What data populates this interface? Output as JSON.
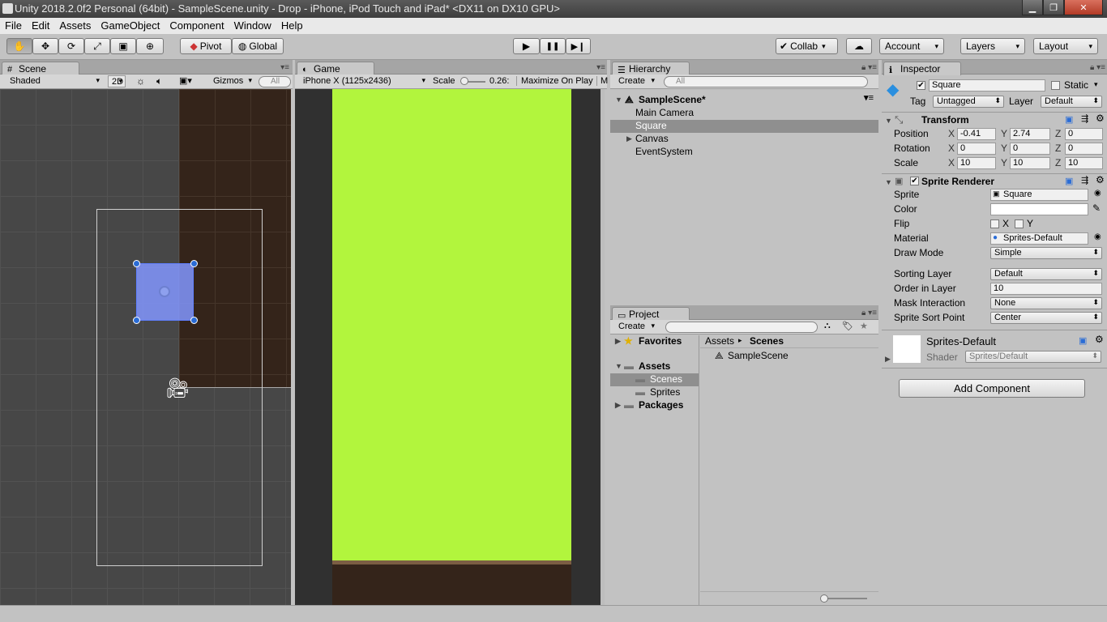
{
  "window": {
    "title": "Unity 2018.2.0f2 Personal (64bit) - SampleScene.unity - Drop - iPhone, iPod Touch and iPad* <DX11 on DX10 GPU>",
    "minimize": "▁",
    "maximize": "❐",
    "close": "✕"
  },
  "menu": [
    "File",
    "Edit",
    "Assets",
    "GameObject",
    "Component",
    "Window",
    "Help"
  ],
  "toolbar": {
    "tools": [
      "hand-icon",
      "move-icon",
      "rotate-icon",
      "scale-icon",
      "rect-icon",
      "transform-icon"
    ],
    "pivot": "Pivot",
    "global": "Global",
    "play": "▶",
    "pause": "❚❚",
    "step": "▶❙",
    "collab": "Collab",
    "account": "Account",
    "layers": "Layers",
    "layout": "Layout"
  },
  "scene": {
    "tab": "Scene",
    "shading": "Shaded",
    "mode2d": "2D",
    "gizmos": "Gizmos",
    "search": "All"
  },
  "game": {
    "tab": "Game",
    "resolution": "iPhone X (1125x2436)",
    "scale_label": "Scale",
    "scale_value": "0.26:",
    "maximize": "Maximize On Play",
    "more": "M",
    "bg_color": "#b2f53d",
    "ground_color": "#34241a"
  },
  "hierarchy": {
    "tab": "Hierarchy",
    "create": "Create",
    "search": "All",
    "scene": "SampleScene*",
    "items": [
      "Main Camera",
      "Square",
      "Canvas",
      "EventSystem"
    ],
    "selected": "Square"
  },
  "project": {
    "tab": "Project",
    "create": "Create",
    "favorites": "Favorites",
    "assets": "Assets",
    "folders": [
      "Scenes",
      "Sprites"
    ],
    "packages": "Packages",
    "breadcrumb_root": "Assets",
    "breadcrumb_current": "Scenes",
    "files": [
      "SampleScene"
    ]
  },
  "inspector": {
    "tab": "Inspector",
    "name": "Square",
    "static": "Static",
    "tag_label": "Tag",
    "tag": "Untagged",
    "layer_label": "Layer",
    "layer": "Default",
    "transform": {
      "title": "Transform",
      "rows": [
        {
          "label": "Position",
          "x": "-0.41",
          "y": "2.74",
          "z": "0"
        },
        {
          "label": "Rotation",
          "x": "0",
          "y": "0",
          "z": "0"
        },
        {
          "label": "Scale",
          "x": "10",
          "y": "10",
          "z": "10"
        }
      ],
      "x": "X",
      "y": "Y",
      "z": "Z"
    },
    "sprite_renderer": {
      "title": "Sprite Renderer",
      "sprite_label": "Sprite",
      "sprite": "Square",
      "color_label": "Color",
      "flip_label": "Flip",
      "flip_x": "X",
      "flip_y": "Y",
      "material_label": "Material",
      "material": "Sprites-Default",
      "draw_mode_label": "Draw Mode",
      "draw_mode": "Simple",
      "sorting_layer_label": "Sorting Layer",
      "sorting_layer": "Default",
      "order_label": "Order in Layer",
      "order": "10",
      "mask_label": "Mask Interaction",
      "mask": "None",
      "sort_point_label": "Sprite Sort Point",
      "sort_point": "Center"
    },
    "material": {
      "name": "Sprites-Default",
      "shader_label": "Shader",
      "shader": "Sprites/Default"
    },
    "add_component": "Add Component"
  }
}
